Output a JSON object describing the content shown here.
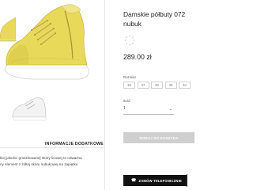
{
  "gallery": {
    "main_image_alt": "",
    "thumbnail_count": 2
  },
  "tabs": {
    "info_label": "INFORMACJE DODATKOWE"
  },
  "description": {
    "line1": "kiej jakości groszkowanej skóry licowej to odważna",
    "line2": "ny element z żółtej skóry nubukowej na zapiętku"
  },
  "product": {
    "title_line1": "Damskie półbuty 072",
    "title_line2": "nubuk",
    "price": "289.00 zł"
  },
  "size_selector": {
    "label": "Rozmiar",
    "options": [
      "36",
      "37",
      "38",
      "39",
      "40"
    ]
  },
  "quantity": {
    "label": "Ilość",
    "value": "1",
    "chevron_icon": "chevron-down-icon"
  },
  "buttons": {
    "add_to_cart": "DODAJ DO KOSZYKA",
    "phone_order": "ZAMÓW TELEFONICZNIE",
    "phone_icon": "phone-icon"
  },
  "colors": {
    "shoe_yellow": "#e8d85a",
    "button_grey": "#cfcfcf",
    "button_black": "#111111"
  }
}
